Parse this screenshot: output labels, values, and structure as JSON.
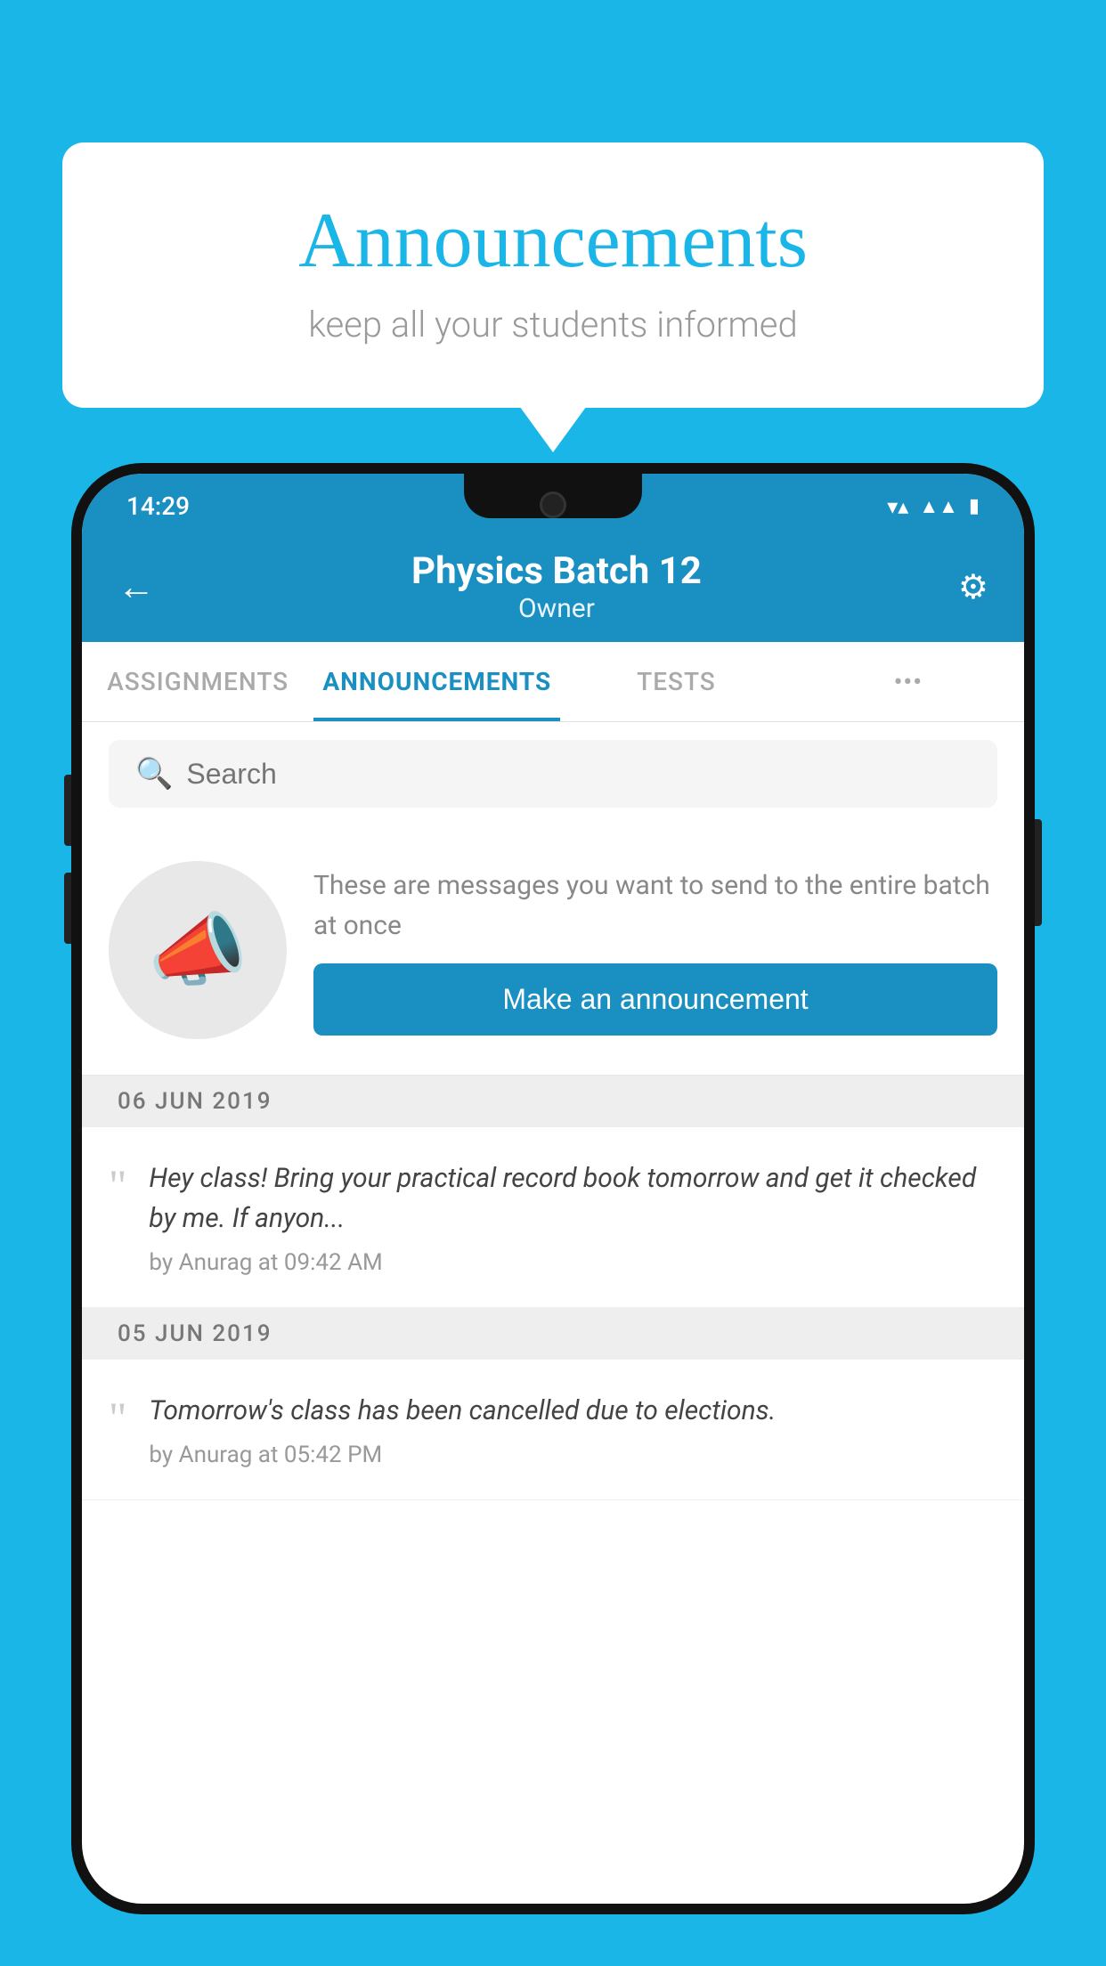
{
  "page": {
    "background_color": "#1ab6e8"
  },
  "speech_bubble": {
    "title": "Announcements",
    "subtitle": "keep all your students informed"
  },
  "status_bar": {
    "time": "14:29",
    "wifi": "▼",
    "signal": "▲",
    "battery": "▮"
  },
  "header": {
    "back_label": "←",
    "title": "Physics Batch 12",
    "subtitle": "Owner",
    "settings_label": "⚙"
  },
  "tabs": [
    {
      "label": "ASSIGNMENTS",
      "active": false
    },
    {
      "label": "ANNOUNCEMENTS",
      "active": true
    },
    {
      "label": "TESTS",
      "active": false
    },
    {
      "label": "•••",
      "active": false
    }
  ],
  "search": {
    "placeholder": "Search"
  },
  "promo": {
    "description_text": "These are messages you want to send to the entire batch at once",
    "cta_label": "Make an announcement"
  },
  "announcements": [
    {
      "date": "06  JUN  2019",
      "text": "Hey class! Bring your practical record book tomorrow and get it checked by me. If anyon...",
      "meta": "by Anurag at 09:42 AM"
    },
    {
      "date": "05  JUN  2019",
      "text": "Tomorrow's class has been cancelled due to elections.",
      "meta": "by Anurag at 05:42 PM"
    }
  ]
}
